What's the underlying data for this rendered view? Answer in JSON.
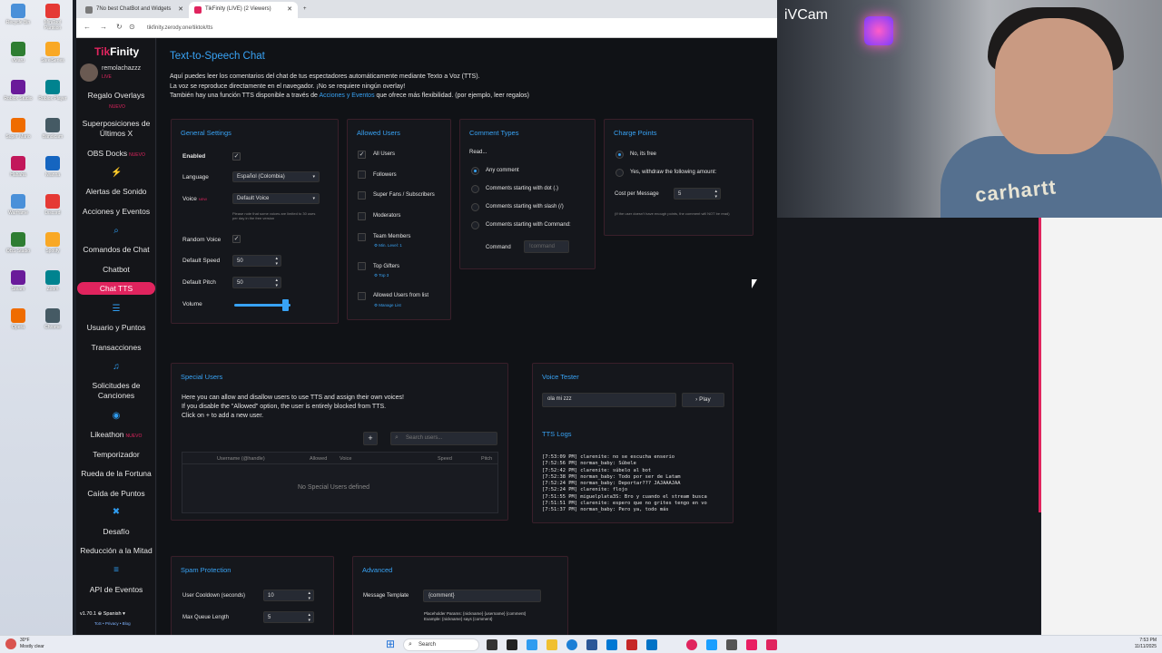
{
  "browser": {
    "tabs": [
      {
        "label": "7No best ChatBot and Widgets"
      },
      {
        "label": "TikFinity (LIVE) (2 Viewers)"
      }
    ],
    "url": "tikfinity.zerody.one/tiktok/tts"
  },
  "sidebar": {
    "logo_a": "Tik",
    "logo_b": "Finity",
    "user_name": "remolachazzz",
    "user_live": "LIVE",
    "new_badge": "NUEVO",
    "items": [
      {
        "label": "Regalo Overlays"
      },
      {
        "label": "Superposiciones de Últimos X"
      },
      {
        "label": "OBS Docks"
      },
      {
        "label": "Alertas de Sonido"
      },
      {
        "label": "Acciones y Eventos"
      },
      {
        "label": "Comandos de Chat"
      },
      {
        "label": "Chatbot"
      },
      {
        "label": "Chat TTS"
      },
      {
        "label": "Usuario y Puntos"
      },
      {
        "label": "Transacciones"
      },
      {
        "label": "Solicitudes de Canciones"
      },
      {
        "label": "Likeathon"
      },
      {
        "label": "Temporizador"
      },
      {
        "label": "Rueda de la Fortuna"
      },
      {
        "label": "Caída de Puntos"
      },
      {
        "label": "Desafío"
      },
      {
        "label": "Reducción a la Mitad"
      },
      {
        "label": "API de Eventos"
      }
    ],
    "version": "v1.70.1",
    "language": "Spanish",
    "footer": "ToS • Privacy • Blog"
  },
  "page": {
    "title": "Text-to-Speech Chat",
    "intro1": "Aquí puedes leer los comentarios del chat de tus espectadores automáticamente mediante Texto a Voz (TTS).",
    "intro2": "La voz se reproduce directamente en el navegador. ¡No se requiere ningún overlay!",
    "intro3a": "También hay una función TTS disponible a través de ",
    "intro3link": "Acciones y Eventos",
    "intro3b": " que ofrece más flexibilidad. (por ejemplo, leer regalos)"
  },
  "general": {
    "title": "General Settings",
    "enabled": "Enabled",
    "language_label": "Language",
    "language_value": "Español (Colombia)",
    "voice_label": "Voice",
    "voice_new": "NEW",
    "voice_value": "Default Voice",
    "voice_note": "Please note that some voices are limited to 30 uses per day in the free version",
    "random_voice": "Random Voice",
    "speed_label": "Default Speed",
    "speed_value": "50",
    "pitch_label": "Default Pitch",
    "pitch_value": "50",
    "volume_label": "Volume",
    "volume_level": 0.9
  },
  "allowed": {
    "title": "Allowed Users",
    "items": [
      {
        "label": "All Users",
        "checked": "✓"
      },
      {
        "label": "Followers",
        "checked": ""
      },
      {
        "label": "Super Fans / Subscribers",
        "checked": ""
      },
      {
        "label": "Moderators",
        "checked": ""
      },
      {
        "label": "Team Members",
        "checked": ""
      },
      {
        "label": "Top Gifters",
        "checked": ""
      },
      {
        "label": "Allowed Users from list",
        "checked": ""
      }
    ],
    "team_sub": "Min. Level: 1",
    "gifters_sub": "Top 3",
    "list_sub": "Manage List"
  },
  "comment_types": {
    "title": "Comment Types",
    "read": "Read...",
    "options": [
      {
        "label": "Any comment"
      },
      {
        "label": "Comments starting with dot (.)"
      },
      {
        "label": "Comments starting with slash (/)"
      },
      {
        "label": "Comments starting with Command:"
      }
    ],
    "command_label": "Command",
    "command_placeholder": "!command"
  },
  "charge": {
    "title": "Charge Points",
    "opt1": "No, its free",
    "opt2": "Yes, withdraw the following amount:",
    "cost_label": "Cost per Message",
    "cost_value": "5",
    "note": "(If the user doesn't have enough points, the comment will NOT be read)"
  },
  "special": {
    "title": "Special Users",
    "desc1": "Here you can allow and disallow users to use TTS and assign their own voices!",
    "desc2": "If you disable the \"Allowed\" option, the user is entirely blocked from TTS.",
    "desc3": "Click on + to add a new user.",
    "search_placeholder": "Search users...",
    "cols": [
      "Username (@handle)",
      "Allowed",
      "Voice",
      "Speed",
      "Pitch"
    ],
    "empty": "No Special Users defined"
  },
  "tester": {
    "title": "Voice Tester",
    "input": "ola mi zzz",
    "play": "Play",
    "logs_title": "TTS Logs",
    "logs": [
      "[7:53:09 PM] clarenite: no se escucha enserio",
      "[7:52:56 PM] norman_baby: Súbele",
      "[7:52:42 PM] clarenite: súbelo al bot",
      "[7:52:38 PM] norman_baby: Todo por ser de Latam",
      "[7:52:24 PM] norman_baby: Deportar??? JAJAAAJAA",
      "[7:52:24 PM] clarenite: flojo",
      "[7:51:55 PM] miguelplata3S: Bro y cuando el stream busca",
      "[7:51:51 PM] clarenite: espero que no grites tengo en vo",
      "[7:51:37 PM] norman_baby: Pero ya, todo más"
    ]
  },
  "spam": {
    "title": "Spam Protection",
    "cooldown_label": "User Cooldown (seconds)",
    "cooldown_value": "10",
    "queue_label": "Max Queue Length",
    "queue_value": "5"
  },
  "advanced": {
    "title": "Advanced",
    "template_label": "Message Template",
    "template_value": "{comment}",
    "placeholders": "Placeholder Params: {nickname} {username} {comment}",
    "example": "Example: {nickname} says {comment}"
  },
  "webcam": {
    "app": "iVCam",
    "shirt": "carhartt"
  },
  "taskbar": {
    "search": "Search",
    "temp": "30°F",
    "weather": "Mostly clear",
    "time": "7:53 PM",
    "date": "11/11/2025"
  },
  "desktop_icons": [
    "Recycle Bin",
    "MiniTool Partition",
    "vMaru",
    "SteelSeries",
    "Roblox Studio",
    "Roblox Player",
    "Super Mario",
    "Bandicam",
    "Hahaha",
    "Iwanna",
    "Warframe",
    "Discord",
    "OBS Studio",
    "Spotify",
    "Steam",
    "Zoom",
    "Opera",
    "Chrome"
  ],
  "colors": {
    "accent": "#38a3f5",
    "brand": "#e0245e",
    "panel_border": "#3a1f2a",
    "background": "#101216"
  }
}
